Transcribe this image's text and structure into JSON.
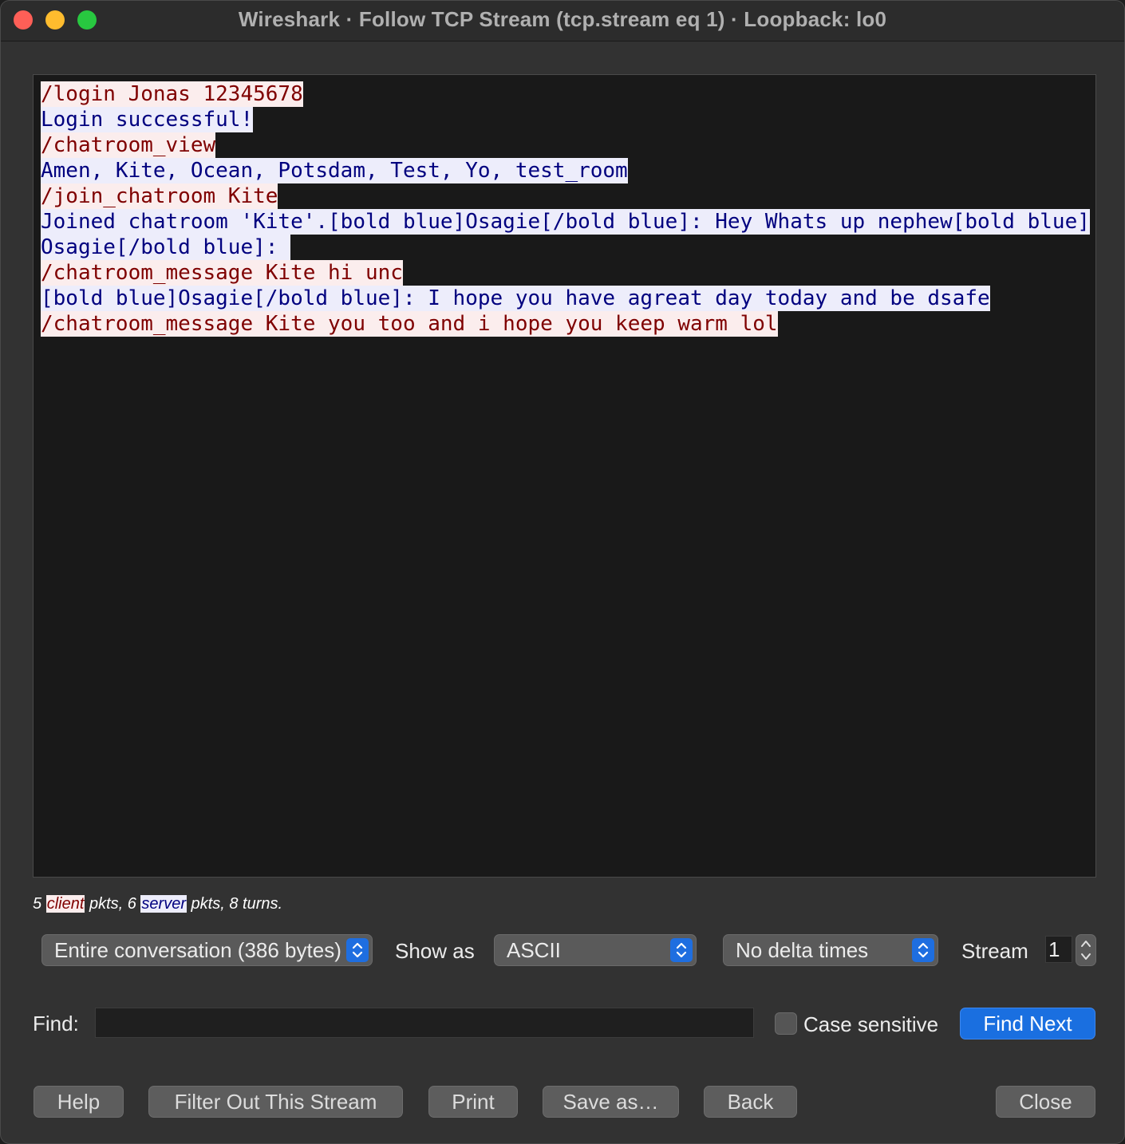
{
  "window": {
    "title": "Wireshark · Follow TCP Stream (tcp.stream eq 1) · Loopback: lo0"
  },
  "stream_lines": [
    {
      "role": "client",
      "text": "/login Jonas 12345678"
    },
    {
      "role": "server",
      "text": "Login successful!"
    },
    {
      "role": "client",
      "text": "/chatroom_view"
    },
    {
      "role": "server",
      "text": "Amen, Kite, Ocean, Potsdam, Test, Yo, test_room"
    },
    {
      "role": "client",
      "text": "/join_chatroom Kite"
    },
    {
      "role": "server",
      "text": "Joined chatroom 'Kite'.[bold blue]Osagie[/bold blue]: Hey Whats up nephew[bold blue]"
    },
    {
      "role": "server",
      "text": "Osagie[/bold blue]: "
    },
    {
      "role": "client",
      "text": "/chatroom_message Kite hi unc"
    },
    {
      "role": "server",
      "text": "[bold blue]Osagie[/bold blue]: I hope you have agreat day today and be dsafe"
    },
    {
      "role": "client",
      "text": "/chatroom_message Kite you too and i hope you keep warm lol"
    }
  ],
  "summary": {
    "client_count": "5 ",
    "client_label": "client",
    "mid": " pkts, 6 ",
    "server_label": "server",
    "tail": " pkts, 8 turns."
  },
  "controls": {
    "conversation_select": "Entire conversation (386 bytes)",
    "show_as_label": "Show as",
    "show_as_value": "ASCII",
    "delta_select": "No delta times",
    "stream_label": "Stream",
    "stream_value": "1"
  },
  "find": {
    "label": "Find:",
    "value": "",
    "case_sensitive_label": "Case sensitive",
    "find_next_label": "Find Next"
  },
  "buttons": {
    "help": "Help",
    "filter_out": "Filter Out This Stream",
    "print": "Print",
    "save_as": "Save as…",
    "back": "Back",
    "close": "Close"
  },
  "colors": {
    "client_bg": "#fbeded",
    "client_fg": "#7f0000",
    "server_bg": "#ededfb",
    "server_fg": "#00007f",
    "accent": "#1a6fe0"
  }
}
